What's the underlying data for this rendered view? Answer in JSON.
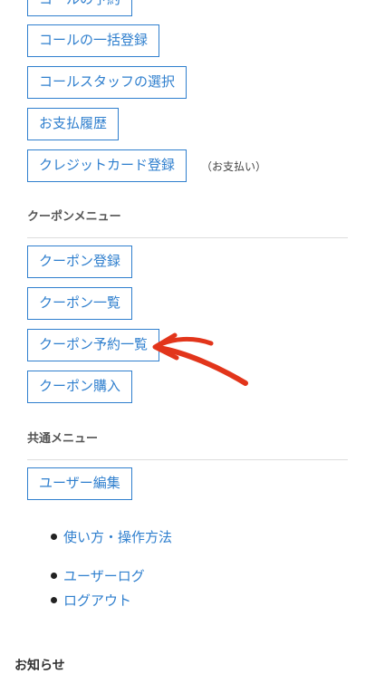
{
  "payment_menu": {
    "call_reserve": "コールの予約",
    "bulk_call": "コールの一括登録",
    "staff_select": "コールスタッフの選択",
    "pay_history": "お支払履歴",
    "credit_card": "クレジットカード登録",
    "credit_note": "（お支払い）"
  },
  "coupon_menu": {
    "title": "クーポンメニュー",
    "register": "クーポン登録",
    "list": "クーポン一覧",
    "reserve_list": "クーポン予約一覧",
    "purchase": "クーポン購入"
  },
  "common_menu": {
    "title": "共通メニュー",
    "user_edit": "ユーザー編集"
  },
  "links": {
    "howto": "使い方・操作方法",
    "user_log": "ユーザーログ",
    "logout": "ログアウト"
  },
  "news_title": "お知らせ",
  "colors": {
    "accent": "#2f7fce",
    "annotation_arrow": "#e2351b"
  }
}
